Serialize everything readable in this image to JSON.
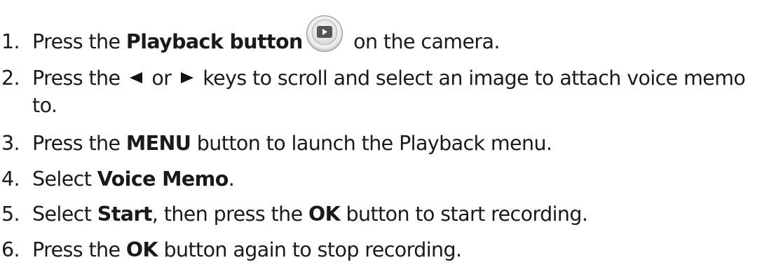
{
  "steps": [
    {
      "num": "1.",
      "t1": "Press the ",
      "b1": "Playback button",
      "t2": " on the camera."
    },
    {
      "num": "2.",
      "t1": "Press the ",
      "t2": " or ",
      "t3": " keys to scroll and select an image to attach voice memo",
      "cont": "to."
    },
    {
      "num": "3.",
      "t1": "Press the ",
      "b1": "MENU",
      "t2": " button to launch the Playback menu."
    },
    {
      "num": "4.",
      "t1": "Select ",
      "b1": "Voice Memo",
      "t2": "."
    },
    {
      "num": "5.",
      "t1": "Select ",
      "b1": "Start",
      "t2": ", then press the ",
      "b2": "OK",
      "t3": " button to start recording."
    },
    {
      "num": "6.",
      "t1": "Press the ",
      "b1": "OK",
      "t2": " button again to stop recording."
    }
  ],
  "icons": {
    "playback": "playback-button-icon",
    "left": "left-arrow-key-icon",
    "right": "right-arrow-key-icon"
  }
}
